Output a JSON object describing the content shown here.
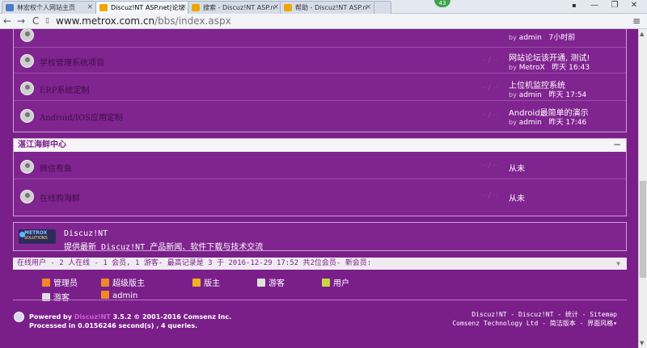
{
  "browser": {
    "tabs": [
      {
        "title": "林宏权个人网站主页",
        "color": "#4a7cc4",
        "active": false
      },
      {
        "title": "Discuz!NT ASP.net|论坛",
        "color": "#f0a500",
        "active": true
      },
      {
        "title": "搜索 - Discuz!NT ASP.n",
        "color": "#f0a500",
        "active": false
      },
      {
        "title": "帮助 - Discuz!NT ASP.n",
        "color": "#f0a500",
        "active": false
      }
    ],
    "tab_close": "×",
    "badge": "43",
    "url_prefix": "www.metrox.com.cn",
    "url_path": "/bbs/index.aspx",
    "back": "←",
    "forward": "→",
    "reload": "C",
    "menu": "≡",
    "min": "—",
    "restore": "❐",
    "close": "✕"
  },
  "forums_top": [
    {
      "name": "",
      "last_title": "",
      "last_by": "admin",
      "last_time": "7小时前"
    },
    {
      "name": "学校管理系统项目",
      "last_title": "网站论坛该开通, 测试!",
      "last_by": "MetroX",
      "last_time": "昨天 16:43"
    },
    {
      "name": "ERP系统定制",
      "last_title": "上位机监控系统",
      "last_by": "admin",
      "last_time": "昨天 17:54"
    },
    {
      "name": "Android/IOS应用定制",
      "last_title": "Android最简单的演示",
      "last_by": "admin",
      "last_time": "昨天 17:46"
    }
  ],
  "by_prefix": "by",
  "category": {
    "title": "湛江海鲜中心",
    "collapse": "−"
  },
  "forums_cat": [
    {
      "name": "微信有鱼",
      "last": "从未"
    },
    {
      "name": "在线购海鲜",
      "last": "从未"
    }
  ],
  "ad": {
    "logo_top": "METROX",
    "logo_bottom": "SOLUTIONS",
    "title": "Discuz!NT",
    "desc": "提供最新 Discuz!NT 产品新闻、软件下载与技术交流"
  },
  "online": {
    "text": "在线用户 - 2 人在线 - 1 会员, 1 游客- 最高记录是 3 于 2016-12-29 17:52  共2位会员- 新会员:",
    "collapse": "▼"
  },
  "groups": [
    {
      "label": "管理员",
      "color": "#f08a24"
    },
    {
      "label": "超级版主",
      "color": "#f08a24"
    },
    {
      "label": "版主",
      "color": "#f0b020"
    },
    {
      "label": "游客",
      "color": "#e0e0e0"
    },
    {
      "label": "用户",
      "color": "#c8d840"
    }
  ],
  "online_users": [
    {
      "label": "游客",
      "color": "#e0e0e0"
    },
    {
      "label": "admin",
      "color": "#f08a24"
    }
  ],
  "footer": {
    "powered_prefix": "Powered by",
    "brand": "Discuz!NT",
    "version": "3.5.2 © 2001-2016 Comsenz Inc.",
    "processed": "Processed in 0.0156246 second(s) , 4 queries.",
    "right1": "Discuz!NT - Discuz!NT - 统计 -   Sitemap",
    "right2": "Comsenz Technology Ltd - 简洁版本 - 界面风格▾"
  }
}
